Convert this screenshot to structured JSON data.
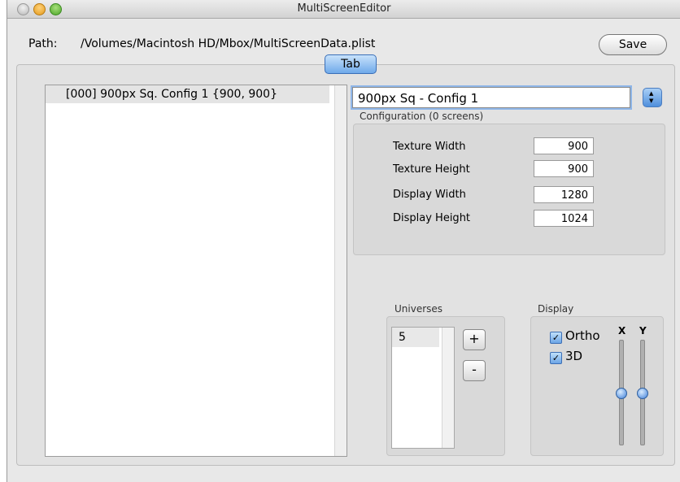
{
  "window": {
    "title": "MultiScreenEditor"
  },
  "path": {
    "label": "Path:",
    "value": "/Volumes/Macintosh HD/Mbox/MultiScreenData.plist"
  },
  "toolbar": {
    "save_label": "Save"
  },
  "tab": {
    "label": "Tab"
  },
  "config_list": {
    "items": [
      {
        "label": "[000] 900px Sq. Config 1 {900, 900}",
        "selected": true
      }
    ]
  },
  "config_name": {
    "value": "900px Sq - Config 1"
  },
  "configuration": {
    "label": "Configuration (0 screens)",
    "fields": [
      {
        "label": "Texture Width",
        "value": "900"
      },
      {
        "label": "Texture Height",
        "value": "900"
      },
      {
        "label": "Display Width",
        "value": "1280"
      },
      {
        "label": "Display Height",
        "value": "1024"
      }
    ]
  },
  "universes": {
    "label": "Universes",
    "items": [
      "5"
    ],
    "add_label": "+",
    "remove_label": "-"
  },
  "display": {
    "label": "Display",
    "ortho_label": "Ortho",
    "ortho_checked": true,
    "threed_label": "3D",
    "threed_checked": true,
    "x_label": "X",
    "y_label": "Y",
    "x_slider_level": 0.5,
    "y_slider_level": 0.5
  },
  "colors": {
    "accent": "#6fa9ea",
    "selection": "#e4e4e4"
  }
}
